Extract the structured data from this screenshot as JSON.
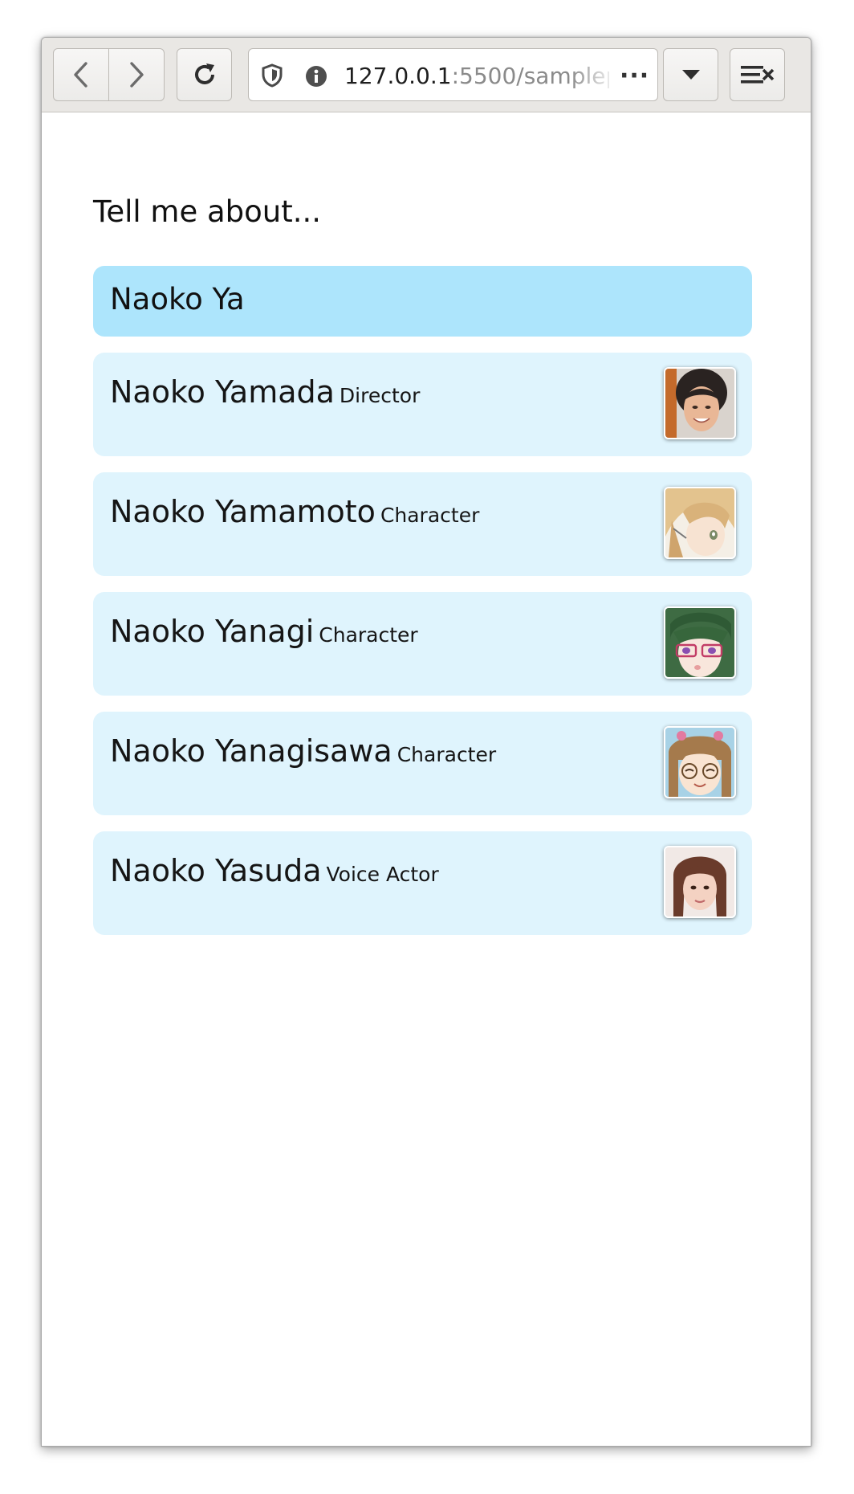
{
  "browser": {
    "url_host": "127.0.0.1",
    "url_path": ":5500/samplep",
    "more_label": "···"
  },
  "page": {
    "prompt": "Tell me about...",
    "search_value": "Naoko Ya"
  },
  "results": [
    {
      "name": "Naoko Yamada",
      "role": "Director",
      "thumb": "real-woman-short-hair-photo"
    },
    {
      "name": "Naoko Yamamoto",
      "role": "Character",
      "thumb": "anime-girl-blonde-hair"
    },
    {
      "name": "Naoko Yanagi",
      "role": "Character",
      "thumb": "anime-girl-green-hair-glasses"
    },
    {
      "name": "Naoko Yanagisawa",
      "role": "Character",
      "thumb": "anime-girl-brown-hair-round-glasses"
    },
    {
      "name": "Naoko Yasuda",
      "role": "Voice Actor",
      "thumb": "real-woman-long-hair-photo"
    }
  ],
  "colors": {
    "search_bg": "#ade5fc",
    "result_bg": "#dff4fd"
  }
}
